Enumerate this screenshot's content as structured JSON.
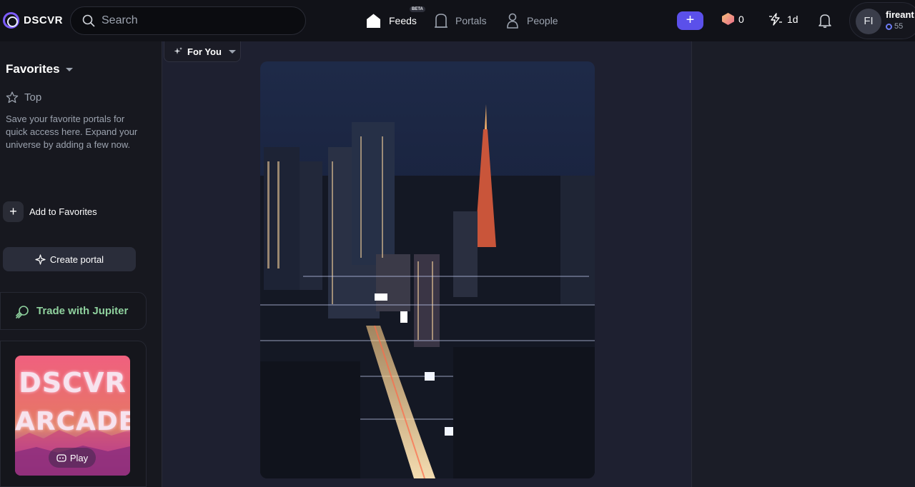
{
  "brand": {
    "name": "DSCVR"
  },
  "search": {
    "placeholder": "Search"
  },
  "nav": {
    "feeds": {
      "label": "Feeds",
      "badge": "BETA"
    },
    "portals": {
      "label": "Portals"
    },
    "people": {
      "label": "People"
    }
  },
  "header": {
    "create_label": "+",
    "gems": "0",
    "streak": "1d",
    "user": {
      "initials": "FI",
      "name": "fireant",
      "points": "55"
    }
  },
  "sidebar": {
    "favorites_title": "Favorites",
    "top_label": "Top",
    "description": "Save your favorite portals for quick access here. Expand your universe by adding a few now.",
    "add_favorites": "Add to Favorites",
    "create_portal": "Create portal",
    "trade_jupiter": "Trade with Jupiter",
    "arcade": {
      "line1": "DSCVR",
      "line2": "ARCADE",
      "play": "Play"
    }
  },
  "feed": {
    "filter_label": "For You"
  },
  "colors": {
    "accent": "#5b50ea",
    "jupiter_green": "#8fd19e",
    "background": "#1b1d27"
  }
}
